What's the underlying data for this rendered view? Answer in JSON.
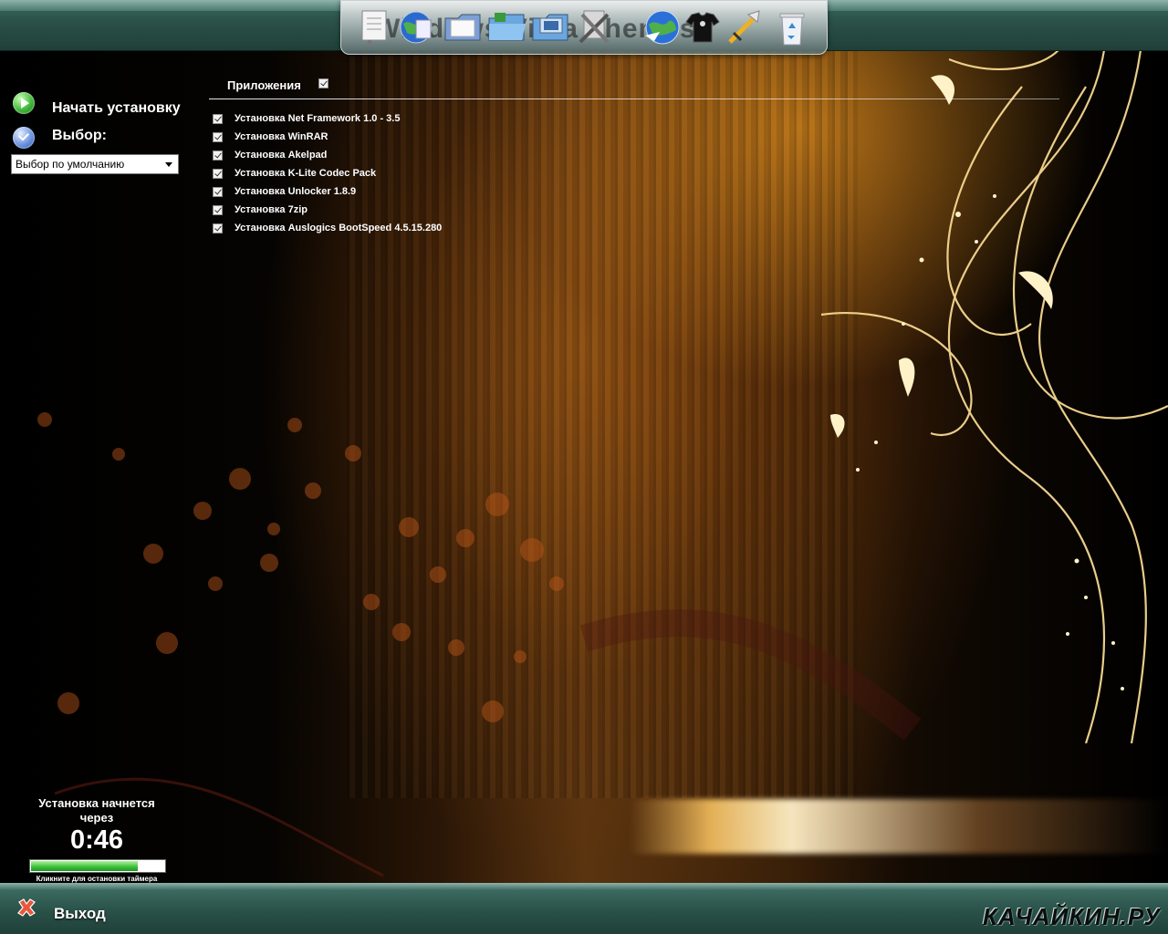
{
  "dock": {
    "ghost_text": "Windows Vista Themes",
    "icons": [
      "notepad-icon",
      "globe-icon",
      "documents-icon",
      "folder-icon",
      "network-folder-icon",
      "pictures-folder-icon",
      "tools-icon",
      "internet-globe-icon",
      "tshirt-icon",
      "sword-icon",
      "recycle-bin-icon"
    ]
  },
  "sidebar": {
    "start_label": "Начать установку",
    "choice_label": "Выбор:",
    "preset_value": "Выбор по умолчанию"
  },
  "apps": {
    "header": "Приложения",
    "header_checked": true,
    "items": [
      {
        "label": "Установка Net Framework 1.0 - 3.5",
        "checked": true
      },
      {
        "label": "Установка WinRAR",
        "checked": true
      },
      {
        "label": "Установка Akelpad",
        "checked": true
      },
      {
        "label": "Установка K-Lite Codec Pack",
        "checked": true
      },
      {
        "label": "Установка Unlocker 1.8.9",
        "checked": true
      },
      {
        "label": "Установка 7zip",
        "checked": true
      },
      {
        "label": "Установка Auslogics BootSpeed 4.5.15.280",
        "checked": true
      }
    ]
  },
  "timer": {
    "title": "Установка начнется через",
    "value": "0:46",
    "progress": 0.8,
    "hint": "Кликните для остановки таймера"
  },
  "footer": {
    "exit_label": "Выход",
    "watermark": "КАЧАЙКИН.РУ"
  },
  "colors": {
    "bar_green": "#2c5249",
    "accent_gold": "#f0c060",
    "progress_green": "#3ec43a"
  }
}
